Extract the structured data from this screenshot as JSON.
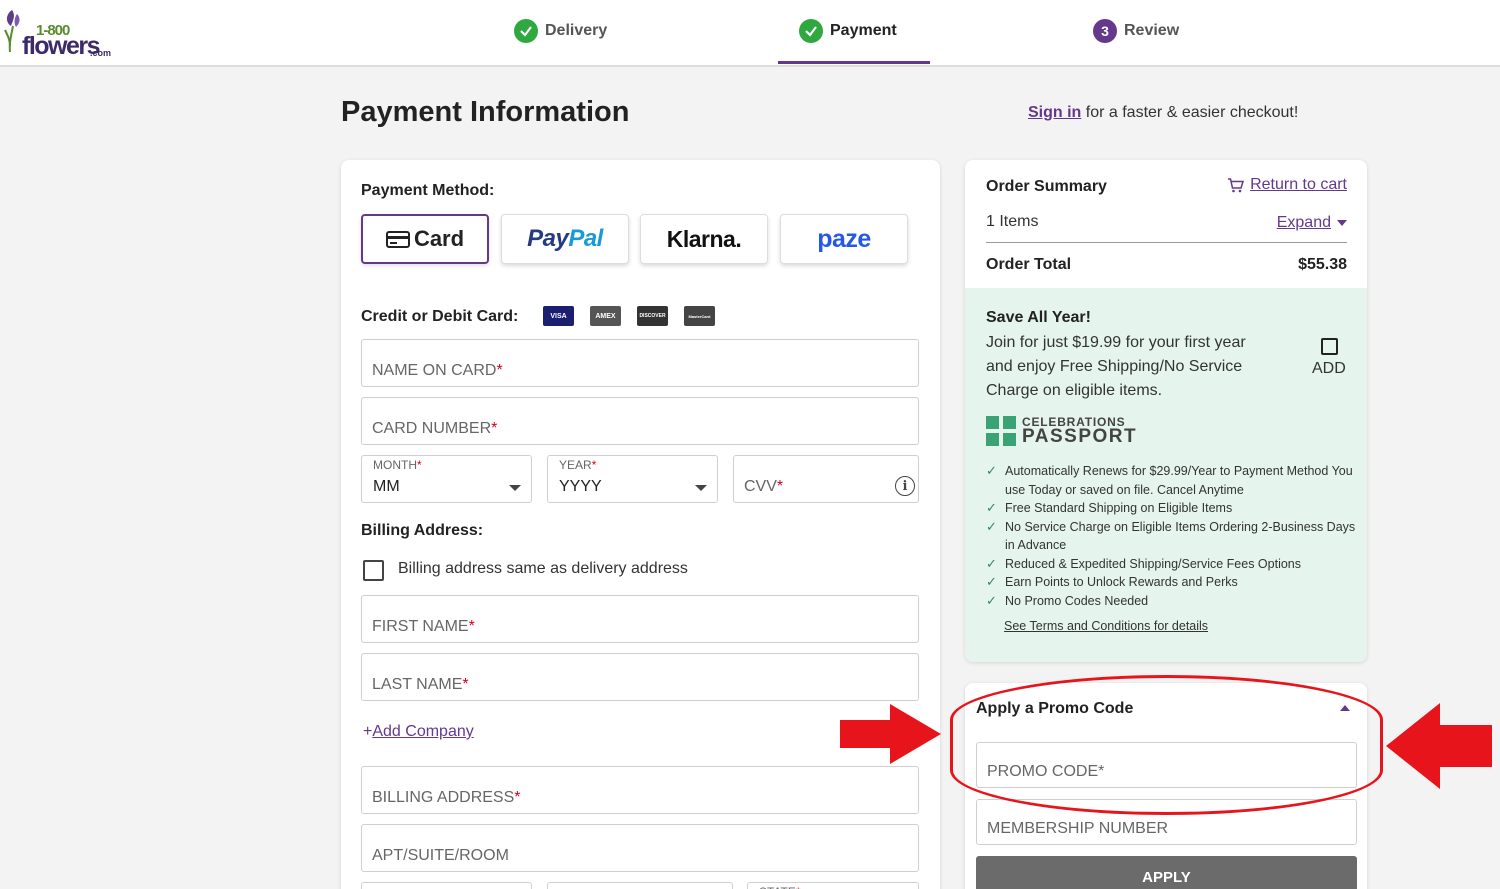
{
  "header": {
    "logo": {
      "number": "1-800",
      "word": "flowers",
      "suffix": ".com"
    },
    "steps": [
      {
        "label": "Delivery",
        "state": "complete"
      },
      {
        "label": "Payment",
        "state": "active"
      },
      {
        "label": "Review",
        "state": "pending",
        "number": "3"
      }
    ]
  },
  "page": {
    "title": "Payment Information",
    "signin_link": "Sign in",
    "signin_suffix": " for a faster & easier checkout!"
  },
  "payment": {
    "method_label": "Payment Method:",
    "methods": {
      "card": "Card",
      "paypal_1": "Pay",
      "paypal_2": "Pal",
      "klarna": "Klarna.",
      "paze": "paze"
    },
    "selected_method": "Card",
    "card_section_label": "Credit or Debit Card:",
    "card_brands": [
      "VISA",
      "AMEX",
      "DISCOVER",
      "MasterCard"
    ],
    "fields": {
      "name_on_card": "NAME ON CARD",
      "card_number": "CARD NUMBER",
      "month_label": "MONTH",
      "month_value": "MM",
      "year_label": "YEAR",
      "year_value": "YYYY",
      "cvv": "CVV",
      "required_mark": "*"
    }
  },
  "billing": {
    "label": "Billing Address:",
    "same_as_delivery": "Billing address same as delivery address",
    "same_as_delivery_checked": false,
    "first_name": "FIRST NAME",
    "last_name": "LAST NAME",
    "add_company_plus": "+",
    "add_company": "Add Company",
    "billing_address": "BILLING ADDRESS",
    "apt": "APT/SUITE/ROOM",
    "state": "STATE"
  },
  "order_summary": {
    "title": "Order Summary",
    "return_to_cart": "Return to cart",
    "items": "1 Items",
    "expand": "Expand",
    "order_total_label": "Order Total",
    "order_total_value": "$55.38"
  },
  "passport": {
    "title": "Save All Year!",
    "description": "Join for just $19.99 for your first year and enjoy Free Shipping/No Service Charge on eligible items.",
    "add_label": "ADD",
    "add_checked": false,
    "logo_line1": "CELEBRATIONS",
    "logo_line2": "PASSPORT",
    "benefits": [
      "Automatically Renews for $29.99/Year to Payment Method You use Today or saved on file. Cancel Anytime",
      "Free Standard Shipping on Eligible Items",
      "No Service Charge on Eligible Items Ordering 2-Business Days in Advance",
      "Reduced & Expedited Shipping/Service Fees Options",
      "Earn Points to Unlock Rewards and Perks",
      "No Promo Codes Needed"
    ],
    "terms_link": "See Terms and Conditions for details"
  },
  "promo": {
    "title": "Apply a Promo Code",
    "promo_placeholder": "PROMO CODE",
    "membership_placeholder": "MEMBERSHIP NUMBER",
    "apply_label": "APPLY"
  },
  "colors": {
    "brand_purple": "#65388b",
    "check_green": "#2ea83f",
    "passport_bg": "#e5f4ed",
    "annotation_red": "#e8141c"
  }
}
